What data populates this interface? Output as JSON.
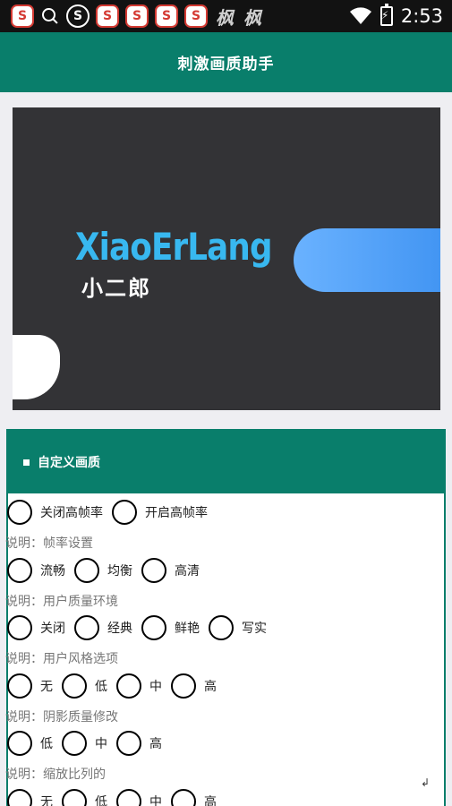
{
  "status_bar": {
    "time": "2:53",
    "app_icons": [
      "S",
      "search-icon",
      "S",
      "S",
      "S",
      "S",
      "S"
    ],
    "brand_chars": [
      "枫",
      "枫"
    ],
    "wifi_icon": "wifi-icon",
    "battery_icon": "battery-charging-icon"
  },
  "app_bar": {
    "title": "刺激画质助手"
  },
  "banner": {
    "brand": "XiaoErLang",
    "subtitle": "小二郎",
    "accent_color": "#3a8ff0",
    "brand_color": "#38b8f0"
  },
  "card": {
    "title": "自定义画质",
    "header_color": "#097e6b",
    "groups": [
      {
        "options": [
          "关闭高帧率",
          "开启高帧率"
        ],
        "description": "说明：帧率设置"
      },
      {
        "options": [
          "流畅",
          "均衡",
          "高清"
        ],
        "description": "说明：用户质量环境"
      },
      {
        "options": [
          "关闭",
          "经典",
          "鲜艳",
          "写实"
        ],
        "description": "说明：用户风格选项"
      },
      {
        "options": [
          "无",
          "低",
          "中",
          "高"
        ],
        "description": "说明：阴影质量修改"
      },
      {
        "options": [
          "低",
          "中",
          "高"
        ],
        "description": "说明：缩放比列的"
      },
      {
        "options": [
          "无",
          "低",
          "中",
          "高"
        ]
      }
    ]
  }
}
